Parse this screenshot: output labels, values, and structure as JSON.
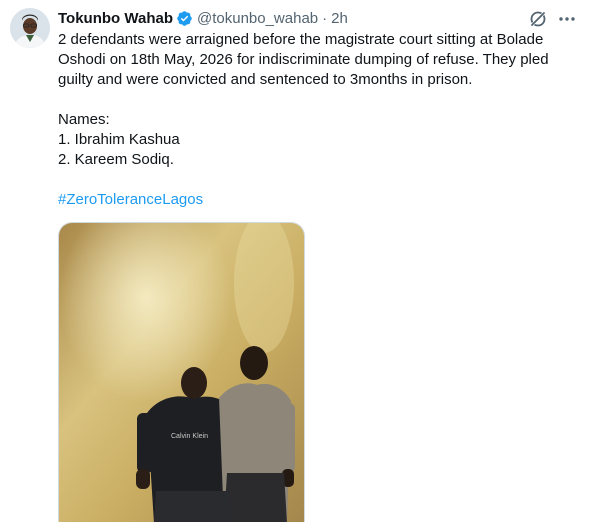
{
  "tweet": {
    "display_name": "Tokunbo Wahab",
    "handle": "@tokunbo_wahab",
    "separator": "·",
    "time": "2h",
    "text_line1": "2 defendants were arraigned before the magistrate court sitting at Bolade Oshodi on 18th May, 2026 for indiscriminate dumping of refuse. They pled guilty and were convicted and sentenced to 3months in prison.",
    "names_heading": "Names:",
    "name_1": "1. Ibrahim Kashua",
    "name_2": "2. Kareem Sodiq.",
    "hashtag": "#ZeroToleranceLagos",
    "shirt_text": "Calvin Klein"
  },
  "icons": {
    "verified": "verified-badge-icon",
    "grok": "grok-icon",
    "more": "more-options-icon"
  },
  "colors": {
    "link": "#1d9bf0",
    "verified": "#1d9bf0",
    "secondary_text": "#536471",
    "primary_text": "#0f1419"
  }
}
